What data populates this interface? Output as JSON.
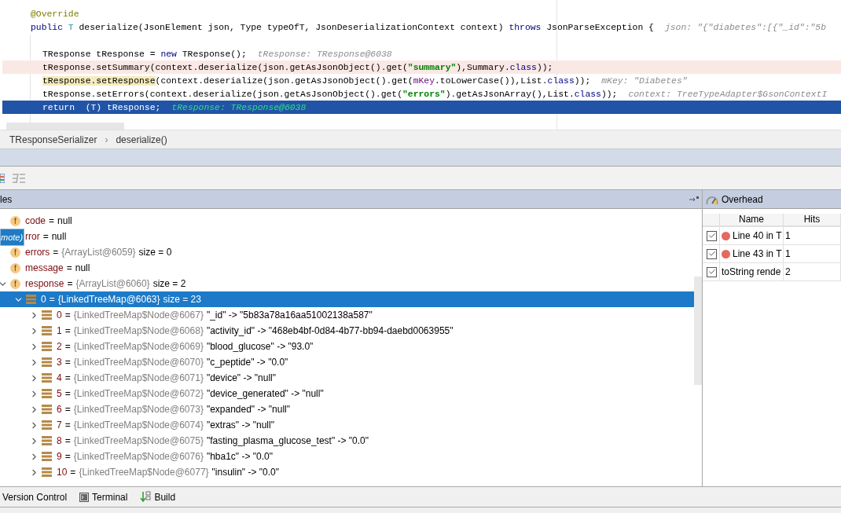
{
  "editor": {
    "lines": [
      {
        "kind": "normal",
        "in_body": false,
        "segments": [
          {
            "kind": "annotation",
            "text": "@Override"
          }
        ]
      },
      {
        "kind": "normal",
        "in_body": false,
        "segments": [
          {
            "kind": "keyword",
            "text": "public"
          },
          {
            "kind": "type",
            "text": " T"
          },
          {
            "kind": "plain",
            "text": " deserialize(JsonElement json, Type typeOfT, JsonDeserializationContext context) "
          },
          {
            "kind": "keyword",
            "text": "throws"
          },
          {
            "kind": "plain",
            "text": " JsonParseException {"
          }
        ],
        "hint": "json: \"{\"diabetes\":[{\"_id\":\"5b"
      },
      {
        "kind": "blank"
      },
      {
        "kind": "normal",
        "in_body": true,
        "segments": [
          {
            "kind": "plain",
            "text": "TResponse tResponse = "
          },
          {
            "kind": "keyword",
            "text": "new"
          },
          {
            "kind": "plain",
            "text": " TResponse();"
          }
        ],
        "hint": "tResponse: TResponse@6038"
      },
      {
        "kind": "breakpoint",
        "in_body": true,
        "segments": [
          {
            "kind": "plain",
            "text": "tResponse.setSummary(context.deserialize(json.getAsJsonObject().get("
          },
          {
            "kind": "string",
            "text": "\"summary\""
          },
          {
            "kind": "plain",
            "text": "),Summary."
          },
          {
            "kind": "keyword",
            "text": "class"
          },
          {
            "kind": "plain",
            "text": "));"
          }
        ]
      },
      {
        "kind": "normal",
        "in_body": true,
        "segments": [
          {
            "kind": "marked",
            "text": "tResponse.setResponse"
          },
          {
            "kind": "plain",
            "text": "(context.deserialize(json.getAsJsonObject().get("
          },
          {
            "kind": "field",
            "text": "mKey"
          },
          {
            "kind": "plain",
            "text": ".toLowerCase()),List."
          },
          {
            "kind": "keyword",
            "text": "class"
          },
          {
            "kind": "plain",
            "text": "));"
          }
        ],
        "hint": "mKey: \"Diabetes\""
      },
      {
        "kind": "normal",
        "in_body": true,
        "segments": [
          {
            "kind": "plain",
            "text": "tResponse.setErrors(context.deserialize(json.getAsJsonObject().get("
          },
          {
            "kind": "string",
            "text": "\"errors\""
          },
          {
            "kind": "plain",
            "text": ").getAsJsonArray(),List."
          },
          {
            "kind": "keyword",
            "text": "class"
          },
          {
            "kind": "plain",
            "text": "));"
          }
        ],
        "hint": "context: TreeTypeAdapter$GsonContextI"
      },
      {
        "kind": "execution",
        "in_body": true,
        "segments": [
          {
            "kind": "plain",
            "text": "return  (T) tResponse;"
          }
        ],
        "hint": "tResponse: TResponse@6038"
      }
    ]
  },
  "breadcrumbs": {
    "items": [
      "TResponseSerializer",
      "deserialize()"
    ],
    "separator": "›"
  },
  "variables": {
    "title": "les",
    "tooltip": "mote)",
    "items": [
      {
        "kind": "field",
        "badge": "f",
        "name": "code",
        "eq": "=",
        "value": "null",
        "selected": false
      },
      {
        "kind": "field",
        "name": "rror",
        "eq": "=",
        "value": "null",
        "selected": false
      },
      {
        "kind": "field",
        "badge": "f",
        "name": "errors",
        "eq": "=",
        "ref": "{ArrayList@6059}",
        "value": "size = 0",
        "selected": false
      },
      {
        "kind": "field",
        "badge": "f",
        "name": "message",
        "eq": "=",
        "value": "null",
        "selected": false
      },
      {
        "kind": "field",
        "badge": "f",
        "name": "response",
        "eq": "=",
        "ref": "{ArrayList@6060}",
        "value": "size = 2",
        "selected": false,
        "expanded": true,
        "children": [
          {
            "kind": "entry",
            "name": "0",
            "eq": "=",
            "ref": "{LinkedTreeMap@6063}",
            "value": "size = 23",
            "selected": true,
            "expanded": true,
            "children": [
              {
                "kind": "entry",
                "name": "0",
                "eq": "=",
                "ref": "{LinkedTreeMap$Node@6067}",
                "value": "\"_id\" -> \"5b83a78a16aa51002138a587\"",
                "selected": false,
                "expanded": false
              },
              {
                "kind": "entry",
                "name": "1",
                "eq": "=",
                "ref": "{LinkedTreeMap$Node@6068}",
                "value": "\"activity_id\" -> \"468eb4bf-0d84-4b77-bb94-daebd0063955\"",
                "selected": false,
                "expanded": false
              },
              {
                "kind": "entry",
                "name": "2",
                "eq": "=",
                "ref": "{LinkedTreeMap$Node@6069}",
                "value": "\"blood_glucose\" -> \"93.0\"",
                "selected": false,
                "expanded": false
              },
              {
                "kind": "entry",
                "name": "3",
                "eq": "=",
                "ref": "{LinkedTreeMap$Node@6070}",
                "value": "\"c_peptide\" -> \"0.0\"",
                "selected": false,
                "expanded": false
              },
              {
                "kind": "entry",
                "name": "4",
                "eq": "=",
                "ref": "{LinkedTreeMap$Node@6071}",
                "value": "\"device\" -> \"null\"",
                "selected": false,
                "expanded": false
              },
              {
                "kind": "entry",
                "name": "5",
                "eq": "=",
                "ref": "{LinkedTreeMap$Node@6072}",
                "value": "\"device_generated\" -> \"null\"",
                "selected": false,
                "expanded": false
              },
              {
                "kind": "entry",
                "name": "6",
                "eq": "=",
                "ref": "{LinkedTreeMap$Node@6073}",
                "value": "\"expanded\" -> \"null\"",
                "selected": false,
                "expanded": false
              },
              {
                "kind": "entry",
                "name": "7",
                "eq": "=",
                "ref": "{LinkedTreeMap$Node@6074}",
                "value": "\"extras\" -> \"null\"",
                "selected": false,
                "expanded": false
              },
              {
                "kind": "entry",
                "name": "8",
                "eq": "=",
                "ref": "{LinkedTreeMap$Node@6075}",
                "value": "\"fasting_plasma_glucose_test\" -> \"0.0\"",
                "selected": false,
                "expanded": false
              },
              {
                "kind": "entry",
                "name": "9",
                "eq": "=",
                "ref": "{LinkedTreeMap$Node@6076}",
                "value": "\"hba1c\" -> \"0.0\"",
                "selected": false,
                "expanded": false
              },
              {
                "kind": "entry",
                "name": "10",
                "eq": "=",
                "ref": "{LinkedTreeMap$Node@6077}",
                "value": "\"insulin\" -> \"0.0\"",
                "selected": false,
                "expanded": false
              }
            ]
          }
        ]
      }
    ]
  },
  "overhead": {
    "title": "Overhead",
    "columns": [
      "Name",
      "Hits"
    ],
    "rows": [
      {
        "kind": "breakpoint",
        "checked": true,
        "name": "Line 40 in T",
        "hits": "1"
      },
      {
        "kind": "breakpoint",
        "checked": true,
        "name": "Line 43 in T",
        "hits": "1"
      },
      {
        "kind": "renderer",
        "checked": true,
        "name": "toString rende",
        "hits": "2"
      }
    ]
  },
  "tool_tabs": [
    {
      "kind": "plain",
      "label": "Version Control"
    },
    {
      "kind": "terminal",
      "label": "Terminal"
    },
    {
      "kind": "build",
      "label": "Build"
    }
  ]
}
